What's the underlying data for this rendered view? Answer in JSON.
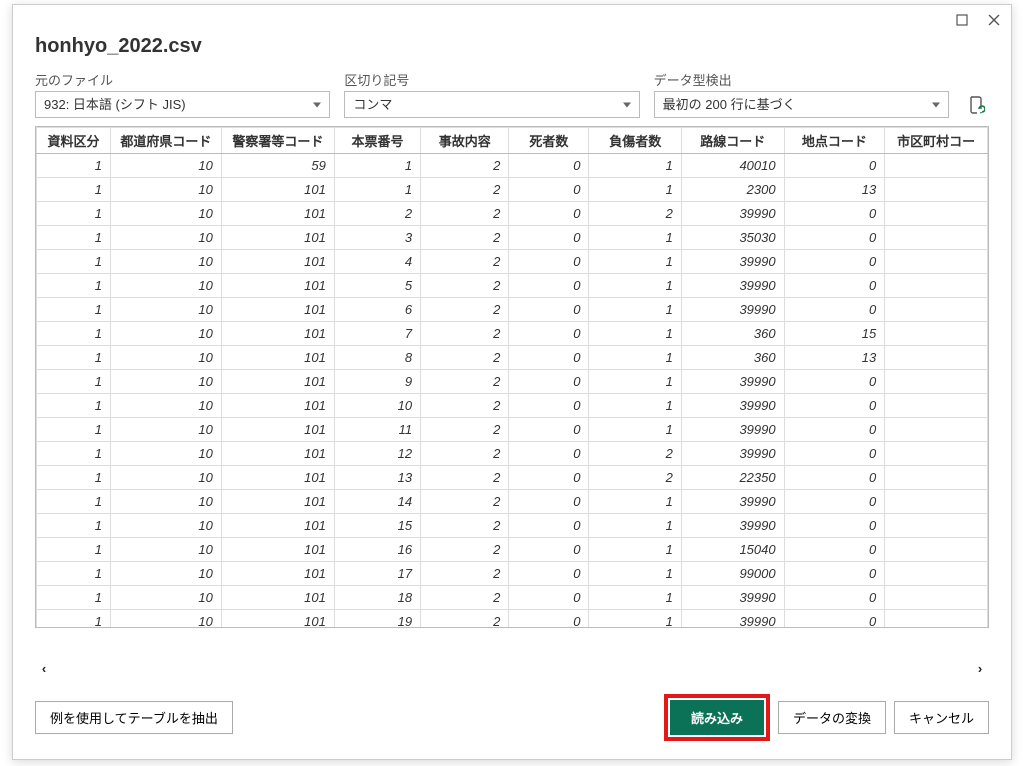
{
  "title": "honhyo_2022.csv",
  "options": {
    "file_origin": {
      "label": "元のファイル",
      "value": "932: 日本語 (シフト JIS)"
    },
    "delimiter": {
      "label": "区切り記号",
      "value": "コンマ"
    },
    "detect": {
      "label": "データ型検出",
      "value": "最初の 200 行に基づく"
    }
  },
  "columns": [
    "資料区分",
    "都道府県コード",
    "警察署等コード",
    "本票番号",
    "事故内容",
    "死者数",
    "負傷者数",
    "路線コード",
    "地点コード",
    "市区町村コー"
  ],
  "rows": [
    [
      1,
      10,
      59,
      1,
      2,
      0,
      1,
      40010,
      0,
      ""
    ],
    [
      1,
      10,
      101,
      1,
      2,
      0,
      1,
      2300,
      13,
      ""
    ],
    [
      1,
      10,
      101,
      2,
      2,
      0,
      2,
      39990,
      0,
      ""
    ],
    [
      1,
      10,
      101,
      3,
      2,
      0,
      1,
      35030,
      0,
      ""
    ],
    [
      1,
      10,
      101,
      4,
      2,
      0,
      1,
      39990,
      0,
      ""
    ],
    [
      1,
      10,
      101,
      5,
      2,
      0,
      1,
      39990,
      0,
      ""
    ],
    [
      1,
      10,
      101,
      6,
      2,
      0,
      1,
      39990,
      0,
      ""
    ],
    [
      1,
      10,
      101,
      7,
      2,
      0,
      1,
      360,
      15,
      ""
    ],
    [
      1,
      10,
      101,
      8,
      2,
      0,
      1,
      360,
      13,
      ""
    ],
    [
      1,
      10,
      101,
      9,
      2,
      0,
      1,
      39990,
      0,
      ""
    ],
    [
      1,
      10,
      101,
      10,
      2,
      0,
      1,
      39990,
      0,
      ""
    ],
    [
      1,
      10,
      101,
      11,
      2,
      0,
      1,
      39990,
      0,
      ""
    ],
    [
      1,
      10,
      101,
      12,
      2,
      0,
      2,
      39990,
      0,
      ""
    ],
    [
      1,
      10,
      101,
      13,
      2,
      0,
      2,
      22350,
      0,
      ""
    ],
    [
      1,
      10,
      101,
      14,
      2,
      0,
      1,
      39990,
      0,
      ""
    ],
    [
      1,
      10,
      101,
      15,
      2,
      0,
      1,
      39990,
      0,
      ""
    ],
    [
      1,
      10,
      101,
      16,
      2,
      0,
      1,
      15040,
      0,
      ""
    ],
    [
      1,
      10,
      101,
      17,
      2,
      0,
      1,
      99000,
      0,
      ""
    ],
    [
      1,
      10,
      101,
      18,
      2,
      0,
      1,
      39990,
      0,
      ""
    ],
    [
      1,
      10,
      101,
      19,
      2,
      0,
      1,
      39990,
      0,
      ""
    ]
  ],
  "buttons": {
    "extract": "例を使用してテーブルを抽出",
    "load": "読み込み",
    "transform": "データの変換",
    "cancel": "キャンセル"
  }
}
